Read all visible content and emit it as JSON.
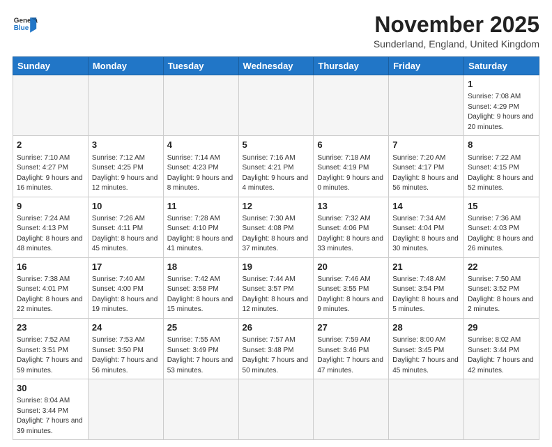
{
  "header": {
    "logo_general": "General",
    "logo_blue": "Blue",
    "month_title": "November 2025",
    "location": "Sunderland, England, United Kingdom"
  },
  "days_of_week": [
    "Sunday",
    "Monday",
    "Tuesday",
    "Wednesday",
    "Thursday",
    "Friday",
    "Saturday"
  ],
  "weeks": [
    [
      {
        "day": "",
        "info": ""
      },
      {
        "day": "",
        "info": ""
      },
      {
        "day": "",
        "info": ""
      },
      {
        "day": "",
        "info": ""
      },
      {
        "day": "",
        "info": ""
      },
      {
        "day": "",
        "info": ""
      },
      {
        "day": "1",
        "info": "Sunrise: 7:08 AM\nSunset: 4:29 PM\nDaylight: 9 hours\nand 20 minutes."
      }
    ],
    [
      {
        "day": "2",
        "info": "Sunrise: 7:10 AM\nSunset: 4:27 PM\nDaylight: 9 hours\nand 16 minutes."
      },
      {
        "day": "3",
        "info": "Sunrise: 7:12 AM\nSunset: 4:25 PM\nDaylight: 9 hours\nand 12 minutes."
      },
      {
        "day": "4",
        "info": "Sunrise: 7:14 AM\nSunset: 4:23 PM\nDaylight: 9 hours\nand 8 minutes."
      },
      {
        "day": "5",
        "info": "Sunrise: 7:16 AM\nSunset: 4:21 PM\nDaylight: 9 hours\nand 4 minutes."
      },
      {
        "day": "6",
        "info": "Sunrise: 7:18 AM\nSunset: 4:19 PM\nDaylight: 9 hours\nand 0 minutes."
      },
      {
        "day": "7",
        "info": "Sunrise: 7:20 AM\nSunset: 4:17 PM\nDaylight: 8 hours\nand 56 minutes."
      },
      {
        "day": "8",
        "info": "Sunrise: 7:22 AM\nSunset: 4:15 PM\nDaylight: 8 hours\nand 52 minutes."
      }
    ],
    [
      {
        "day": "9",
        "info": "Sunrise: 7:24 AM\nSunset: 4:13 PM\nDaylight: 8 hours\nand 48 minutes."
      },
      {
        "day": "10",
        "info": "Sunrise: 7:26 AM\nSunset: 4:11 PM\nDaylight: 8 hours\nand 45 minutes."
      },
      {
        "day": "11",
        "info": "Sunrise: 7:28 AM\nSunset: 4:10 PM\nDaylight: 8 hours\nand 41 minutes."
      },
      {
        "day": "12",
        "info": "Sunrise: 7:30 AM\nSunset: 4:08 PM\nDaylight: 8 hours\nand 37 minutes."
      },
      {
        "day": "13",
        "info": "Sunrise: 7:32 AM\nSunset: 4:06 PM\nDaylight: 8 hours\nand 33 minutes."
      },
      {
        "day": "14",
        "info": "Sunrise: 7:34 AM\nSunset: 4:04 PM\nDaylight: 8 hours\nand 30 minutes."
      },
      {
        "day": "15",
        "info": "Sunrise: 7:36 AM\nSunset: 4:03 PM\nDaylight: 8 hours\nand 26 minutes."
      }
    ],
    [
      {
        "day": "16",
        "info": "Sunrise: 7:38 AM\nSunset: 4:01 PM\nDaylight: 8 hours\nand 22 minutes."
      },
      {
        "day": "17",
        "info": "Sunrise: 7:40 AM\nSunset: 4:00 PM\nDaylight: 8 hours\nand 19 minutes."
      },
      {
        "day": "18",
        "info": "Sunrise: 7:42 AM\nSunset: 3:58 PM\nDaylight: 8 hours\nand 15 minutes."
      },
      {
        "day": "19",
        "info": "Sunrise: 7:44 AM\nSunset: 3:57 PM\nDaylight: 8 hours\nand 12 minutes."
      },
      {
        "day": "20",
        "info": "Sunrise: 7:46 AM\nSunset: 3:55 PM\nDaylight: 8 hours\nand 9 minutes."
      },
      {
        "day": "21",
        "info": "Sunrise: 7:48 AM\nSunset: 3:54 PM\nDaylight: 8 hours\nand 5 minutes."
      },
      {
        "day": "22",
        "info": "Sunrise: 7:50 AM\nSunset: 3:52 PM\nDaylight: 8 hours\nand 2 minutes."
      }
    ],
    [
      {
        "day": "23",
        "info": "Sunrise: 7:52 AM\nSunset: 3:51 PM\nDaylight: 7 hours\nand 59 minutes."
      },
      {
        "day": "24",
        "info": "Sunrise: 7:53 AM\nSunset: 3:50 PM\nDaylight: 7 hours\nand 56 minutes."
      },
      {
        "day": "25",
        "info": "Sunrise: 7:55 AM\nSunset: 3:49 PM\nDaylight: 7 hours\nand 53 minutes."
      },
      {
        "day": "26",
        "info": "Sunrise: 7:57 AM\nSunset: 3:48 PM\nDaylight: 7 hours\nand 50 minutes."
      },
      {
        "day": "27",
        "info": "Sunrise: 7:59 AM\nSunset: 3:46 PM\nDaylight: 7 hours\nand 47 minutes."
      },
      {
        "day": "28",
        "info": "Sunrise: 8:00 AM\nSunset: 3:45 PM\nDaylight: 7 hours\nand 45 minutes."
      },
      {
        "day": "29",
        "info": "Sunrise: 8:02 AM\nSunset: 3:44 PM\nDaylight: 7 hours\nand 42 minutes."
      }
    ],
    [
      {
        "day": "30",
        "info": "Sunrise: 8:04 AM\nSunset: 3:44 PM\nDaylight: 7 hours\nand 39 minutes."
      },
      {
        "day": "",
        "info": ""
      },
      {
        "day": "",
        "info": ""
      },
      {
        "day": "",
        "info": ""
      },
      {
        "day": "",
        "info": ""
      },
      {
        "day": "",
        "info": ""
      },
      {
        "day": "",
        "info": ""
      }
    ]
  ]
}
